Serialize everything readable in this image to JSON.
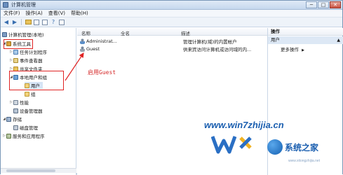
{
  "window": {
    "title": "计算机管理",
    "controls": [
      "─",
      "□",
      "✕"
    ]
  },
  "menubar": {
    "items": [
      "文件(F)",
      "操作(A)",
      "查看(V)",
      "帮助(H)"
    ]
  },
  "toolbar": {
    "icons": [
      "back-arrow-icon",
      "forward-arrow-icon",
      "folder-icon",
      "box-icon",
      "properties-icon",
      "help-icon",
      "view-icon"
    ]
  },
  "tree": {
    "root": "计算机管理(本地)",
    "system_tools": "系统工具",
    "task_scheduler": "任务计划程序",
    "event_viewer": "事件查看器",
    "shared_folders": "共享文件夹",
    "local_users_groups": "本地用户和组",
    "users": "用户",
    "groups": "组",
    "performance": "性能",
    "device_manager": "设备管理器",
    "storage": "存储",
    "disk_management": "磁盘管理",
    "services_apps": "服务和应用程序"
  },
  "list": {
    "columns": {
      "name": "名称",
      "fullname": "全名",
      "description": "描述"
    },
    "rows": [
      {
        "name": "Administrat...",
        "description": "管理计算机(域)的内置帐户"
      },
      {
        "name": "Guest",
        "description": "供来宾访问计算机或访问域的内..."
      }
    ]
  },
  "actions": {
    "header": "操作",
    "section": "用户",
    "more": "更多操作"
  },
  "annotation": {
    "callout": "启用Guest",
    "color": "#e02424"
  },
  "watermark": {
    "url": "www.win7zhijia.cn",
    "brand": "系统之家",
    "small": "www.xitongzhijia.net"
  }
}
